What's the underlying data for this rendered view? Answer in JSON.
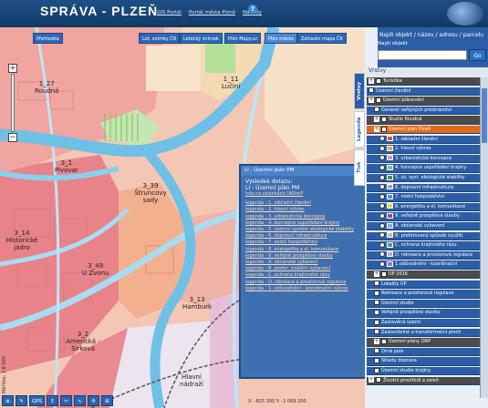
{
  "header": {
    "title": "SPRÁVA - PLZEŇ",
    "links": [
      "GIS Portál",
      "Portál města Plzně",
      "Návody"
    ],
    "help": "?"
  },
  "map": {
    "toolbar": {
      "prehledka": "Přehledka",
      "buttons": [
        "Let. snímky ČR",
        "Letecký snímek",
        "Plán Mapy.cz",
        "Plán města",
        "Základní mapa ČR"
      ]
    },
    "zoom_in": "+",
    "zoom_out": "−",
    "labels": [
      {
        "id": "1_27",
        "name": "Roudná"
      },
      {
        "id": "1_11",
        "name": "Lučiní"
      },
      {
        "id": "3_1",
        "name": "Pivovar"
      },
      {
        "id": "3_39",
        "name": "Štruncovy sady"
      },
      {
        "id": "3_14",
        "name": "Historické jádro"
      },
      {
        "id": "3_49",
        "name": "U Zvonu"
      },
      {
        "id": "3_13",
        "name": "Hamburk"
      },
      {
        "id": "3_2",
        "name": "Americká - Sirková"
      },
      {
        "id": "",
        "name": "Hlavní nádraží"
      }
    ],
    "bottom_tools": [
      "⊕",
      "✎",
      "GPS",
      "↕",
      "✂",
      "∿",
      "✣",
      "⊞"
    ],
    "coords": "X: -825 300  Y: -1 069 200",
    "scale": "Měřítko: 1:8 000"
  },
  "popup": {
    "title": "LI - Územní plán PM",
    "result_heading": "Výsledek dotazu:",
    "result_value": "LI - Územní plán PM",
    "info_link": "Info na stránkách ÚKRmP",
    "links": [
      "legenda - 1. základní členění",
      "legenda - 2. hlavní výkres",
      "legenda - 3. urbanistická koncepce",
      "legenda - 4. koncepce uspořádání krajiny",
      "legenda - 5. územní systém ekologické stability",
      "legenda - 6. dopravní infrastruktura",
      "legenda - 7. vodní hospodářství",
      "legenda - 8. energetika a el. komunikace",
      "legenda - 9. veřejně prospěšné stavby",
      "legenda - A. občanské vybavení",
      "legenda - B. prefer. zvláštní vybavení",
      "legenda - C. ochrana krajinného rázu",
      "legenda - D. rekreace a prostorová regulace",
      "legenda - 1. odůvodnění - koordinační výkres"
    ]
  },
  "panel": {
    "search_title": "Najdi objekt / název / adresu / parcelu",
    "search_label": "Najdi objekt",
    "search_placeholder": "",
    "search_button": "Go",
    "layers_heading": "Vrstvy",
    "side_tabs": [
      "Vrstvy",
      "Legenda",
      "Tisk"
    ],
    "layers": [
      {
        "label": "Turistika",
        "type": "group",
        "indent": 0
      },
      {
        "label": "Územní členění",
        "type": "item",
        "indent": 0
      },
      {
        "label": "Územní plánování",
        "type": "group",
        "indent": 0
      },
      {
        "label": "Generel veřejných prostranství",
        "type": "item",
        "indent": 1
      },
      {
        "label": "Studie Roudná",
        "type": "group",
        "indent": 1
      },
      {
        "label": "Územní plán Plzeň",
        "type": "hl",
        "indent": 1
      },
      {
        "label": "1. základní členění",
        "type": "item",
        "indent": 2
      },
      {
        "label": "2. hlavní výkres",
        "type": "item",
        "indent": 2
      },
      {
        "label": "3. urbanistická koncepce",
        "type": "item",
        "indent": 2
      },
      {
        "label": "4. koncepce uspořádání krajiny",
        "type": "item",
        "indent": 2
      },
      {
        "label": "5. úz. syst. ekologické stability",
        "type": "item",
        "indent": 2
      },
      {
        "label": "6. dopravní infrastruktura",
        "type": "item",
        "indent": 2
      },
      {
        "label": "7. vodní hospodářství",
        "type": "item",
        "indent": 2
      },
      {
        "label": "8. energetika a el. komunikace",
        "type": "item",
        "indent": 2
      },
      {
        "label": "9. veřejně prospěšné stavby",
        "type": "item",
        "indent": 2
      },
      {
        "label": "A. občanské vybavení",
        "type": "item",
        "indent": 2
      },
      {
        "label": "B. preferovaný způsob využití",
        "type": "item",
        "indent": 2
      },
      {
        "label": "C. ochrana krajinného rázu",
        "type": "item",
        "indent": 2
      },
      {
        "label": "D. rekreace a prostorová regulace",
        "type": "item",
        "indent": 2
      },
      {
        "label": "1.odůvodnění - koordinační",
        "type": "item",
        "indent": 2
      },
      {
        "label": "ÚP 2016",
        "type": "group",
        "indent": 1
      },
      {
        "label": "Lokality ÚP",
        "type": "item",
        "indent": 1
      },
      {
        "label": "Rekreace a prostorová regulace",
        "type": "item",
        "indent": 1
      },
      {
        "label": "Územní studie",
        "type": "item",
        "indent": 1
      },
      {
        "label": "Veřejně prospěšné stavby",
        "type": "item",
        "indent": 1
      },
      {
        "label": "Zastavěná území",
        "type": "item",
        "indent": 1
      },
      {
        "label": "Zastavitelné a transformační ploch",
        "type": "item",
        "indent": 1
      },
      {
        "label": "Územní plány ORP",
        "type": "group",
        "indent": 1
      },
      {
        "label": "Orná pole",
        "type": "item",
        "indent": 1
      },
      {
        "label": "Sklady doprava",
        "type": "item",
        "indent": 1
      },
      {
        "label": "Územní studie krajiny",
        "type": "item",
        "indent": 1
      },
      {
        "label": "Životní prostředí a zeleň",
        "type": "group",
        "indent": 0
      }
    ]
  },
  "colors": {
    "accent": "#2b5ea6",
    "highlight": "#e36a14",
    "river": "#7fc8ea",
    "road": "#a5d8f0"
  }
}
